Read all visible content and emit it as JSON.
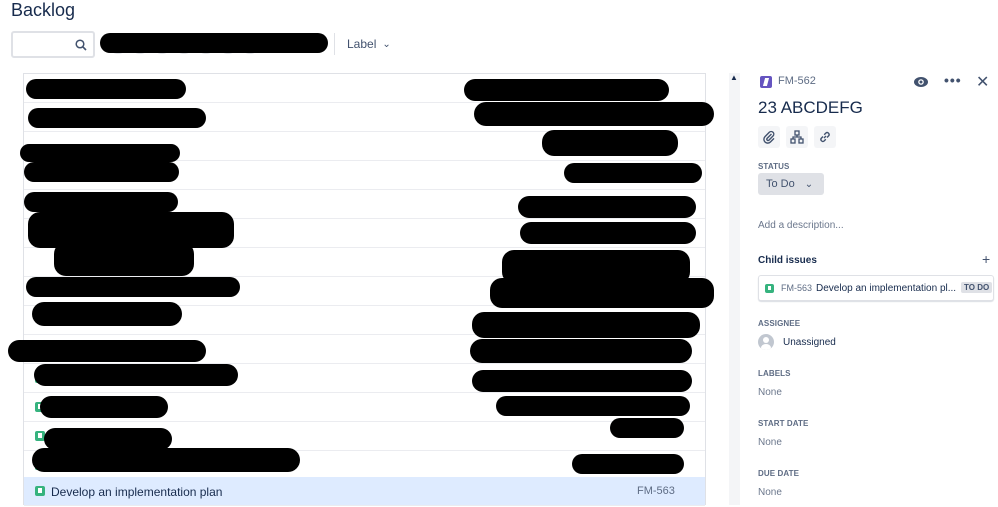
{
  "page": {
    "title": "Backlog"
  },
  "toolbar": {
    "search_placeholder": "",
    "label_filter": "Label"
  },
  "backlog": {
    "rows": [
      {
        "summary": "",
        "key": ""
      },
      {
        "summary": "",
        "key": ""
      },
      {
        "summary": "",
        "key": ""
      },
      {
        "summary": "",
        "key": ""
      },
      {
        "summary": "",
        "key": ""
      },
      {
        "summary": "",
        "key": ""
      },
      {
        "summary": "",
        "key": ""
      },
      {
        "summary": "",
        "key": ""
      },
      {
        "summary": "",
        "key": ""
      },
      {
        "summary": "",
        "key": ""
      },
      {
        "summary": "",
        "key": ""
      },
      {
        "summary": "",
        "key": ""
      },
      {
        "summary": "",
        "key": ""
      },
      {
        "summary": "",
        "key": ""
      },
      {
        "summary": "Develop an implementation plan",
        "key": "FM-563"
      }
    ]
  },
  "detail": {
    "epic_key": "FM-562",
    "title": "23 ABCDEFG",
    "status_label": "STATUS",
    "status_value": "To Do",
    "description_placeholder": "Add a description...",
    "child_issues_label": "Child issues",
    "child_issue": {
      "key": "FM-563",
      "summary": "Develop an implementation pl...",
      "status": "TO DO"
    },
    "assignee_label": "ASSIGNEE",
    "assignee_value": "Unassigned",
    "labels_label": "LABELS",
    "labels_value": "None",
    "start_date_label": "START DATE",
    "start_date_value": "None",
    "due_date_label": "DUE DATE",
    "due_date_value": "None"
  },
  "colors": {
    "story": "#36b37e",
    "epic": "#6554c0",
    "selected_row": "#deebff"
  }
}
